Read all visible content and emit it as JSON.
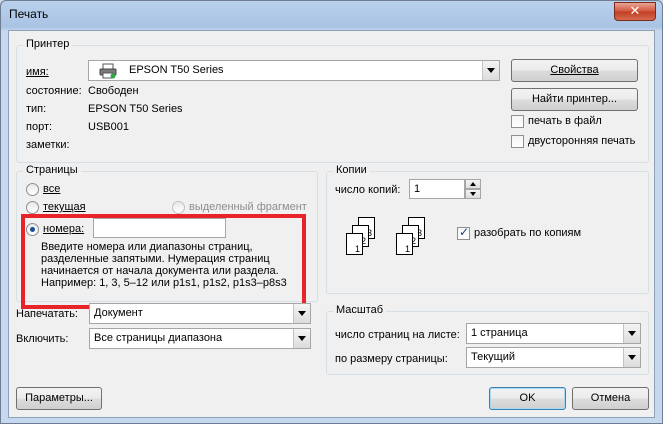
{
  "window": {
    "title": "Печать",
    "close_label": "✕"
  },
  "printer": {
    "group_title": "Принтер",
    "name_label": "имя:",
    "name_value": "EPSON T50 Series",
    "status_label": "состояние:",
    "status_value": "Свободен",
    "type_label": "тип:",
    "type_value": "EPSON T50 Series",
    "port_label": "порт:",
    "port_value": "USB001",
    "comment_label": "заметки:",
    "properties_button": "Свойства",
    "find_button": "Найти принтер...",
    "print_to_file": "печать в файл",
    "duplex": "двусторонняя печать"
  },
  "pages": {
    "group_title": "Страницы",
    "all": "все",
    "current": "текущая",
    "selection": "выделенный фрагмент",
    "numbers": "номера:",
    "numbers_value": "",
    "hint": "Введите номера или диапазоны страниц, разделенные запятыми. Нумерация страниц начинается от начала документа или раздела. Например: 1, 3, 5–12 или p1s1, p1s2, p1s3–p8s3"
  },
  "copies": {
    "group_title": "Копии",
    "count_label": "число копий:",
    "count_value": "1",
    "collate": "разобрать по копиям",
    "page_labels": [
      "1",
      "2",
      "3"
    ]
  },
  "print_what": {
    "label": "Напечатать:",
    "value": "Документ"
  },
  "include": {
    "label": "Включить:",
    "value": "Все страницы диапазона"
  },
  "scale": {
    "group_title": "Масштаб",
    "pages_per_sheet_label": "число страниц на листе:",
    "pages_per_sheet_value": "1 страница",
    "fit_label": "по размеру страницы:",
    "fit_value": "Текущий"
  },
  "buttons": {
    "options": "Параметры...",
    "ok": "OK",
    "cancel": "Отмена"
  }
}
